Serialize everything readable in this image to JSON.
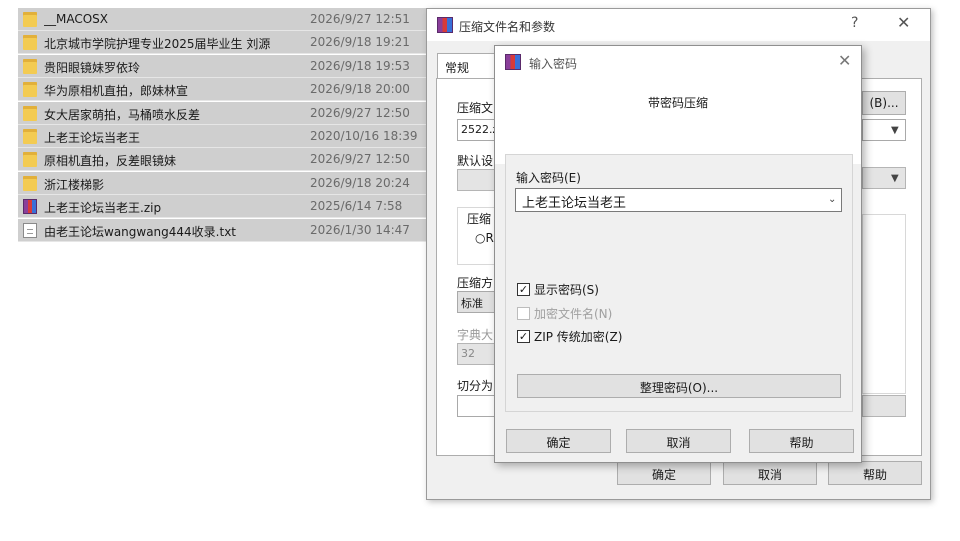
{
  "file_list": [
    {
      "name": "__MACOSX",
      "date": "2026/9/27 12:51",
      "type": "folder"
    },
    {
      "name": "北京城市学院护理专业2025届毕业生 刘源",
      "date": "2026/9/18 19:21",
      "type": "folder"
    },
    {
      "name": "贵阳眼镜妹罗依玲",
      "date": "2026/9/18 19:53",
      "type": "folder"
    },
    {
      "name": "华为原相机直拍，郎妹林宣",
      "date": "2026/9/18 20:00",
      "type": "folder"
    },
    {
      "name": "女大居家萌拍，马桶喷水反差",
      "date": "2026/9/27 12:50",
      "type": "folder"
    },
    {
      "name": "上老王论坛当老王",
      "date": "2020/10/16 18:39",
      "type": "folder"
    },
    {
      "name": "原相机直拍，反差眼镜妹",
      "date": "2026/9/27 12:50",
      "type": "folder"
    },
    {
      "name": "浙江楼梯影",
      "date": "2026/9/18 20:24",
      "type": "folder"
    },
    {
      "name": "上老王论坛当老王.zip",
      "date": "2025/6/14 7:58",
      "type": "zip"
    },
    {
      "name": "由老王论坛wangwang444收录.txt",
      "date": "2026/1/30 14:47",
      "type": "txt"
    }
  ],
  "main_dialog": {
    "title": "压缩文件名和参数",
    "help_glyph": "?",
    "close_glyph": "✕",
    "tab_general": "常规",
    "archive_name_label": "压缩文",
    "archive_name_value": "2522.z",
    "browse_button": "(B)...",
    "default_label": "默认设",
    "compress_format_label": "压缩",
    "radio_partial": "R",
    "method_label": "压缩方",
    "method_value": "标准",
    "dict_label": "字典大",
    "dict_value": "32",
    "split_label": "切分为",
    "ok": "确定",
    "cancel": "取消",
    "help": "帮助"
  },
  "password_dialog": {
    "title": "输入密码",
    "close_glyph": "✕",
    "heading": "带密码压缩",
    "enter_label": "输入密码(E)",
    "password_value": "上老王论坛当老王",
    "show_password": {
      "label": "显示密码(S)",
      "checked": true
    },
    "encrypt_names": {
      "label": "加密文件名(N)",
      "checked": false,
      "disabled": true
    },
    "zip_legacy": {
      "label": "ZIP 传统加密(Z)",
      "checked": true
    },
    "manage_button": "整理密码(O)...",
    "ok": "确定",
    "cancel": "取消",
    "help": "帮助"
  }
}
